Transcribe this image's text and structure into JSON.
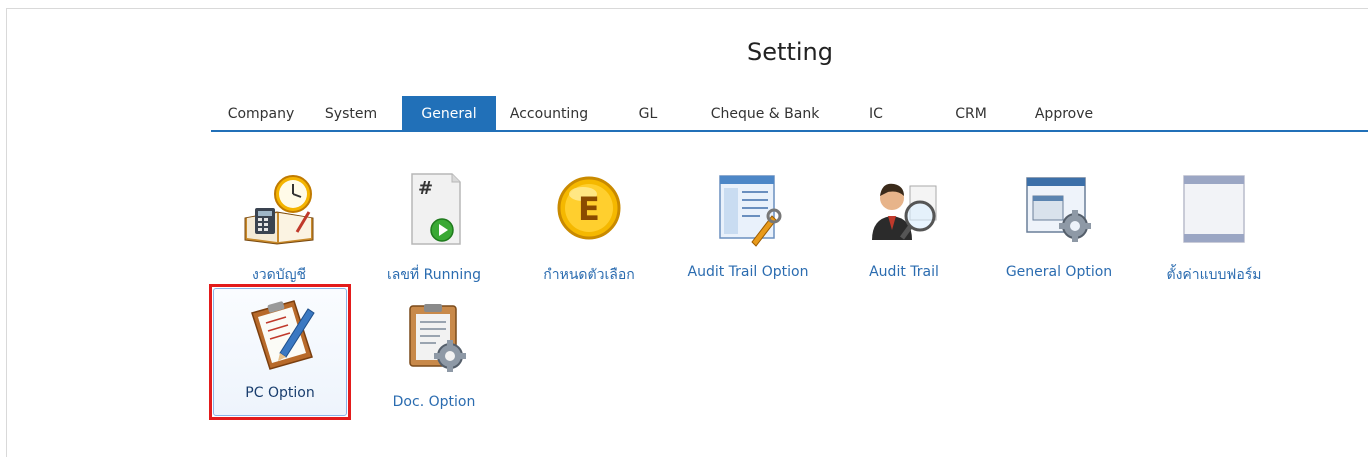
{
  "header": {
    "title": "Setting"
  },
  "tabs": [
    {
      "label": "Company"
    },
    {
      "label": "System"
    },
    {
      "label": "General"
    },
    {
      "label": "Accounting"
    },
    {
      "label": "GL"
    },
    {
      "label": "Cheque & Bank"
    },
    {
      "label": "IC"
    },
    {
      "label": "CRM"
    },
    {
      "label": "Approve"
    }
  ],
  "active_tab": "General",
  "items": [
    {
      "label": "งวดบัญชี",
      "icon": "calendar-clock-book-icon"
    },
    {
      "label": "เลขที่ Running",
      "icon": "running-number-document-icon"
    },
    {
      "label": "กำหนดตัวเลือก",
      "icon": "gold-e-coin-icon"
    },
    {
      "label": "Audit Trail Option",
      "icon": "audit-trail-option-window-icon"
    },
    {
      "label": "Audit Trail",
      "icon": "audit-user-magnifier-icon"
    },
    {
      "label": "General Option",
      "icon": "general-option-window-gear-icon"
    },
    {
      "label": "ตั้งค่าแบบฟอร์ม",
      "icon": "blank-form-icon"
    },
    {
      "label": "PC Option",
      "icon": "clipboard-pen-icon"
    },
    {
      "label": "Doc. Option",
      "icon": "clipboard-gear-icon"
    }
  ],
  "selected_item": "PC Option",
  "colors": {
    "accent": "#2170b8",
    "link": "#2b6cb0",
    "selection_border": "#e31b1b"
  }
}
